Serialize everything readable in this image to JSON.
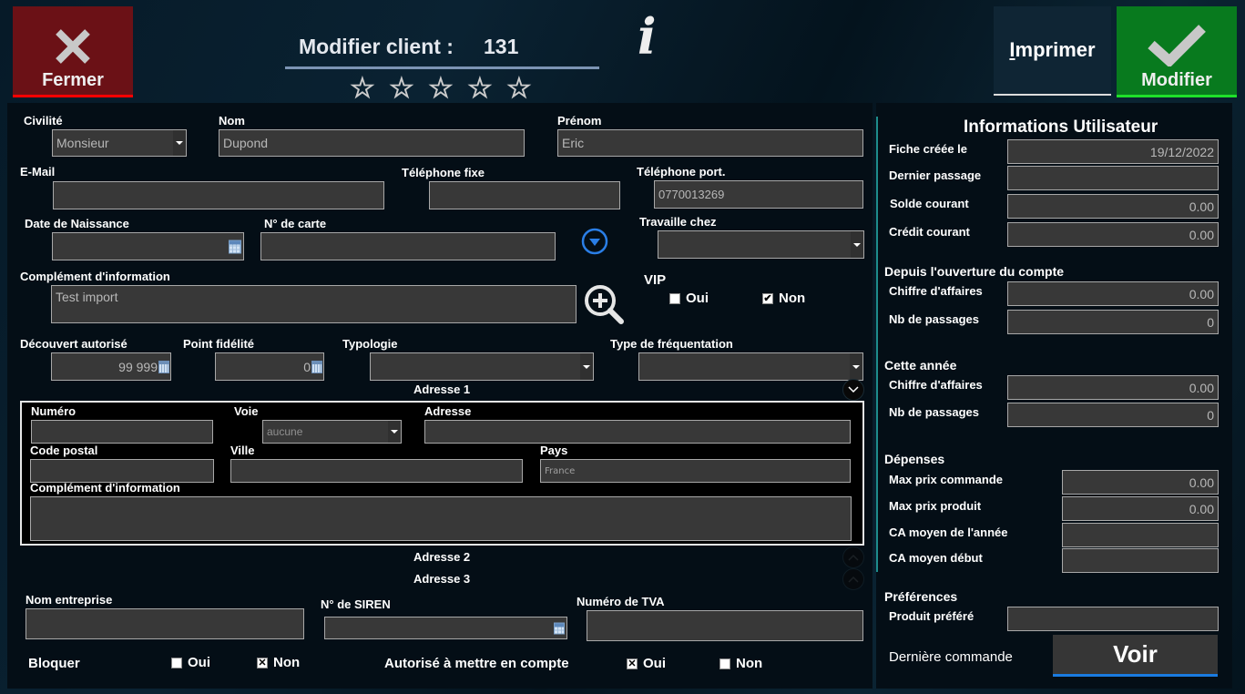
{
  "header": {
    "close_label": "Fermer",
    "title_label": "Modifier client :",
    "client_number": "131",
    "rating": {
      "value": 0,
      "max": 5
    },
    "print_label": "Imprimer",
    "print_accesskey": "I",
    "print_rest": "mprimer",
    "modify_label": "Modifier"
  },
  "form": {
    "civilite": {
      "label": "Civilité",
      "value": "Monsieur"
    },
    "nom": {
      "label": "Nom",
      "value": "Dupond"
    },
    "prenom": {
      "label": "Prénom",
      "value": "Eric"
    },
    "email": {
      "label": "E-Mail",
      "value": ""
    },
    "tel_fixe": {
      "label": "Téléphone fixe",
      "value": ""
    },
    "tel_port": {
      "label": "Téléphone port.",
      "value": "0770013269"
    },
    "date_naissance": {
      "label": "Date de Naissance",
      "value": ""
    },
    "num_carte": {
      "label": "N° de carte",
      "value": ""
    },
    "travaille_chez": {
      "label": "Travaille chez",
      "value": ""
    },
    "complement": {
      "label": "Complément d'information",
      "value": "Test import"
    },
    "vip": {
      "label": "VIP",
      "oui_label": "Oui",
      "non_label": "Non",
      "oui_checked": false,
      "non_checked": true
    },
    "decouvert": {
      "label": "Découvert autorisé",
      "value": "99 999"
    },
    "point_fidelite": {
      "label": "Point fidélité",
      "value": "0"
    },
    "typologie": {
      "label": "Typologie",
      "value": ""
    },
    "type_frequentation": {
      "label": "Type de fréquentation",
      "value": ""
    }
  },
  "address": {
    "section1_label": "Adresse 1",
    "section2_label": "Adresse 2",
    "section3_label": "Adresse 3",
    "numero": {
      "label": "Numéro",
      "value": ""
    },
    "voie": {
      "label": "Voie",
      "value": "aucune"
    },
    "adresse": {
      "label": "Adresse",
      "value": ""
    },
    "code_postal": {
      "label": "Code postal",
      "value": ""
    },
    "ville": {
      "label": "Ville",
      "value": ""
    },
    "pays": {
      "label": "Pays",
      "value": "France"
    },
    "complement": {
      "label": "Complément d'information",
      "value": ""
    }
  },
  "company": {
    "nom_entreprise": {
      "label": "Nom entreprise",
      "value": ""
    },
    "siren": {
      "label": "N° de SIREN",
      "value": ""
    },
    "tva": {
      "label": "Numéro de TVA",
      "value": ""
    }
  },
  "bloquer": {
    "label": "Bloquer",
    "oui_label": "Oui",
    "non_label": "Non",
    "oui_checked": false,
    "non_checked": true,
    "mark": "✕"
  },
  "autorise": {
    "label": "Autorisé à mettre en compte",
    "oui_label": "Oui",
    "non_label": "Non",
    "oui_checked": true,
    "non_checked": false,
    "mark": "✕"
  },
  "vip_mark": "✔",
  "user_info": {
    "title": "Informations Utilisateur",
    "fiche_creee": {
      "label": "Fiche créée le",
      "value": "19/12/2022"
    },
    "dernier_passage": {
      "label": "Dernier passage",
      "value": ""
    },
    "solde_courant": {
      "label": "Solde courant",
      "value": "0.00"
    },
    "credit_courant": {
      "label": "Crédit courant",
      "value": "0.00"
    },
    "depuis_ouverture": {
      "title": "Depuis l'ouverture du compte",
      "ca": {
        "label": "Chiffre d'affaires",
        "value": "0.00"
      },
      "nb_passages": {
        "label": "Nb de passages",
        "value": "0"
      }
    },
    "cette_annee": {
      "title": "Cette année",
      "ca": {
        "label": "Chiffre d'affaires",
        "value": "0.00"
      },
      "nb_passages": {
        "label": "Nb de passages",
        "value": "0"
      }
    },
    "depenses": {
      "title": "Dépenses",
      "max_prix_commande": {
        "label": "Max prix commande",
        "value": "0.00"
      },
      "max_prix_produit": {
        "label": "Max prix produit",
        "value": "0.00"
      },
      "ca_moyen_annee": {
        "label": "CA moyen de l'année",
        "value": ""
      },
      "ca_moyen_debut": {
        "label": "CA moyen début",
        "value": ""
      }
    },
    "preferences": {
      "title": "Préférences",
      "produit_prefere": {
        "label": "Produit préféré",
        "value": ""
      }
    },
    "derniere_commande": {
      "label": "Dernière commande",
      "button_label": "Voir"
    }
  },
  "icons": {
    "close": "✕",
    "check": "✔",
    "info": "i",
    "star": "☆",
    "chevron_down": "⌄",
    "chevron_up": "⌃"
  },
  "colors": {
    "close_button": "#6b1116",
    "close_accent": "#ff0000",
    "modify_button": "#087a1e",
    "modify_accent": "#1fe02a",
    "input_bg": "#383838",
    "voir_accent": "#1a7be0",
    "divider": "#1e8c8c"
  }
}
